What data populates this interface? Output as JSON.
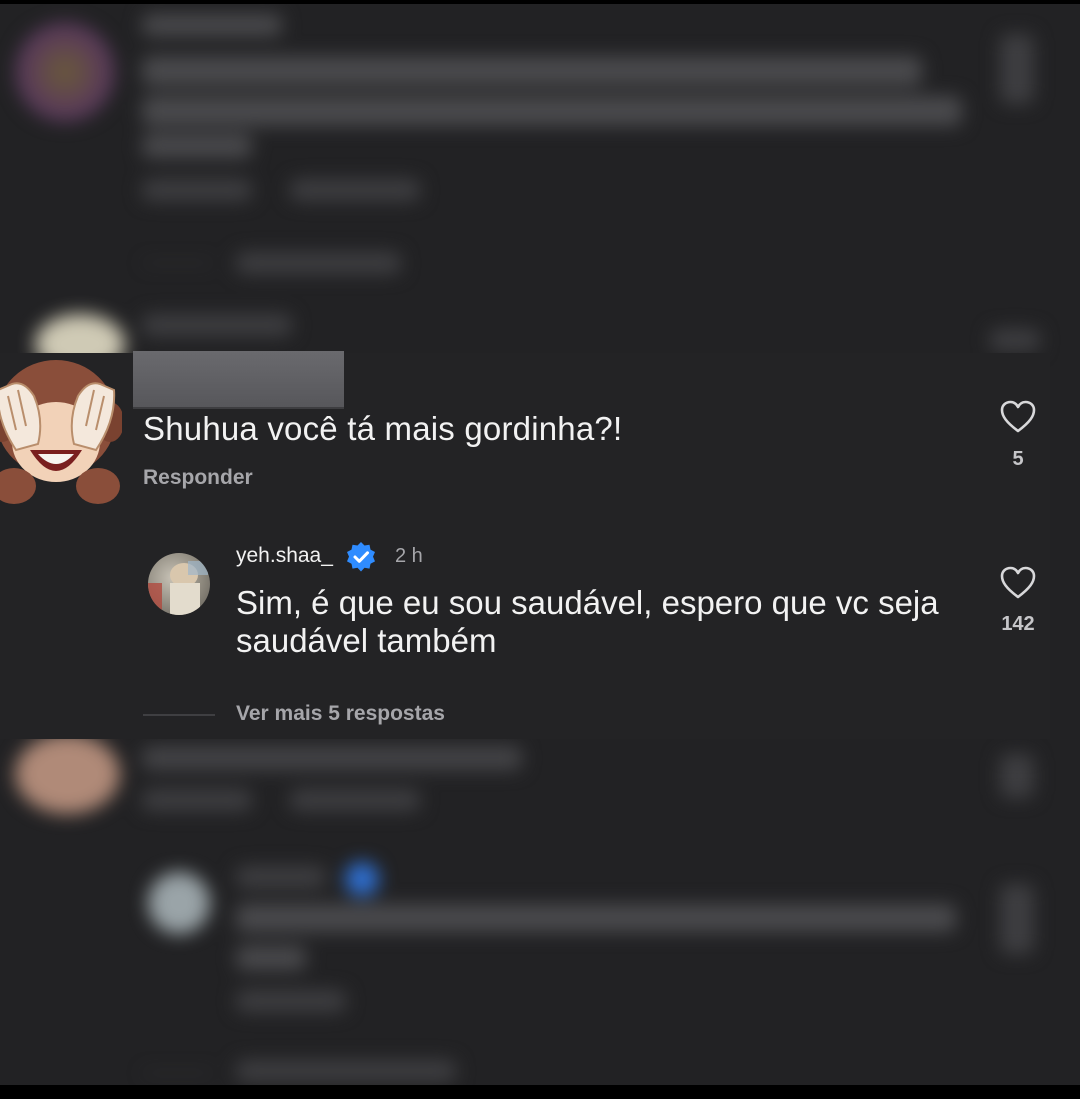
{
  "comment": {
    "text": "Shuhua você tá mais gordinha?!",
    "reply_label": "Responder",
    "like_count": "5",
    "icons": {
      "heart": "heart-icon",
      "sticker": "see-no-evil-monkey-icon"
    }
  },
  "reply": {
    "username": "yeh.shaa_",
    "time": "2 h",
    "text": "Sim, é que eu sou saudável, espero que vc seja saudável também",
    "like_count": "142",
    "icons": {
      "verified": "verified-badge-icon",
      "heart": "heart-icon"
    }
  },
  "view_more": "Ver mais 5 respostas",
  "colors": {
    "background": "#222224",
    "text": "#f2f2f2",
    "secondary_text": "#a6a6aa",
    "verified_blue": "#2f8cff"
  }
}
